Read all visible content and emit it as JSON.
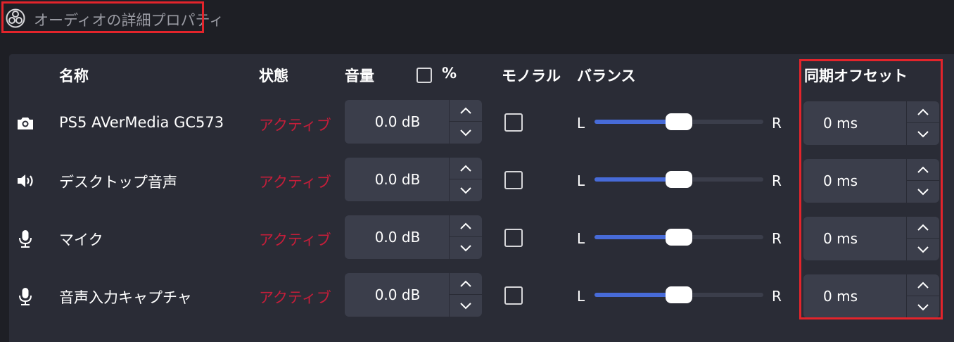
{
  "window": {
    "title": "オーディオの詳細プロパティ",
    "icon": "obs-logo-icon"
  },
  "headers": {
    "name": "名称",
    "status": "状態",
    "volume": "音量",
    "percent": "%",
    "mono": "モノラル",
    "balance": "バランス",
    "sync_offset": "同期オフセット"
  },
  "rows": [
    {
      "icon": "camera-icon",
      "name": "PS5 AVerMedia GC573",
      "status": "アクティブ",
      "volume": "0.0 dB",
      "mono": false,
      "balance_left": "L",
      "balance_right": "R",
      "balance_value": 0.5,
      "offset": "0 ms"
    },
    {
      "icon": "speaker-icon",
      "name": "デスクトップ音声",
      "status": "アクティブ",
      "volume": "0.0 dB",
      "mono": false,
      "balance_left": "L",
      "balance_right": "R",
      "balance_value": 0.5,
      "offset": "0 ms"
    },
    {
      "icon": "microphone-icon",
      "name": "マイク",
      "status": "アクティブ",
      "volume": "0.0 dB",
      "mono": false,
      "balance_left": "L",
      "balance_right": "R",
      "balance_value": 0.5,
      "offset": "0 ms"
    },
    {
      "icon": "microphone-icon",
      "name": "音声入力キャプチャ",
      "status": "アクティブ",
      "volume": "0.0 dB",
      "mono": false,
      "balance_left": "L",
      "balance_right": "R",
      "balance_value": 0.5,
      "offset": "0 ms"
    }
  ],
  "colors": {
    "status_active": "#c41e3a",
    "highlight_box": "#e3242b",
    "slider_fill": "#476bd8"
  }
}
